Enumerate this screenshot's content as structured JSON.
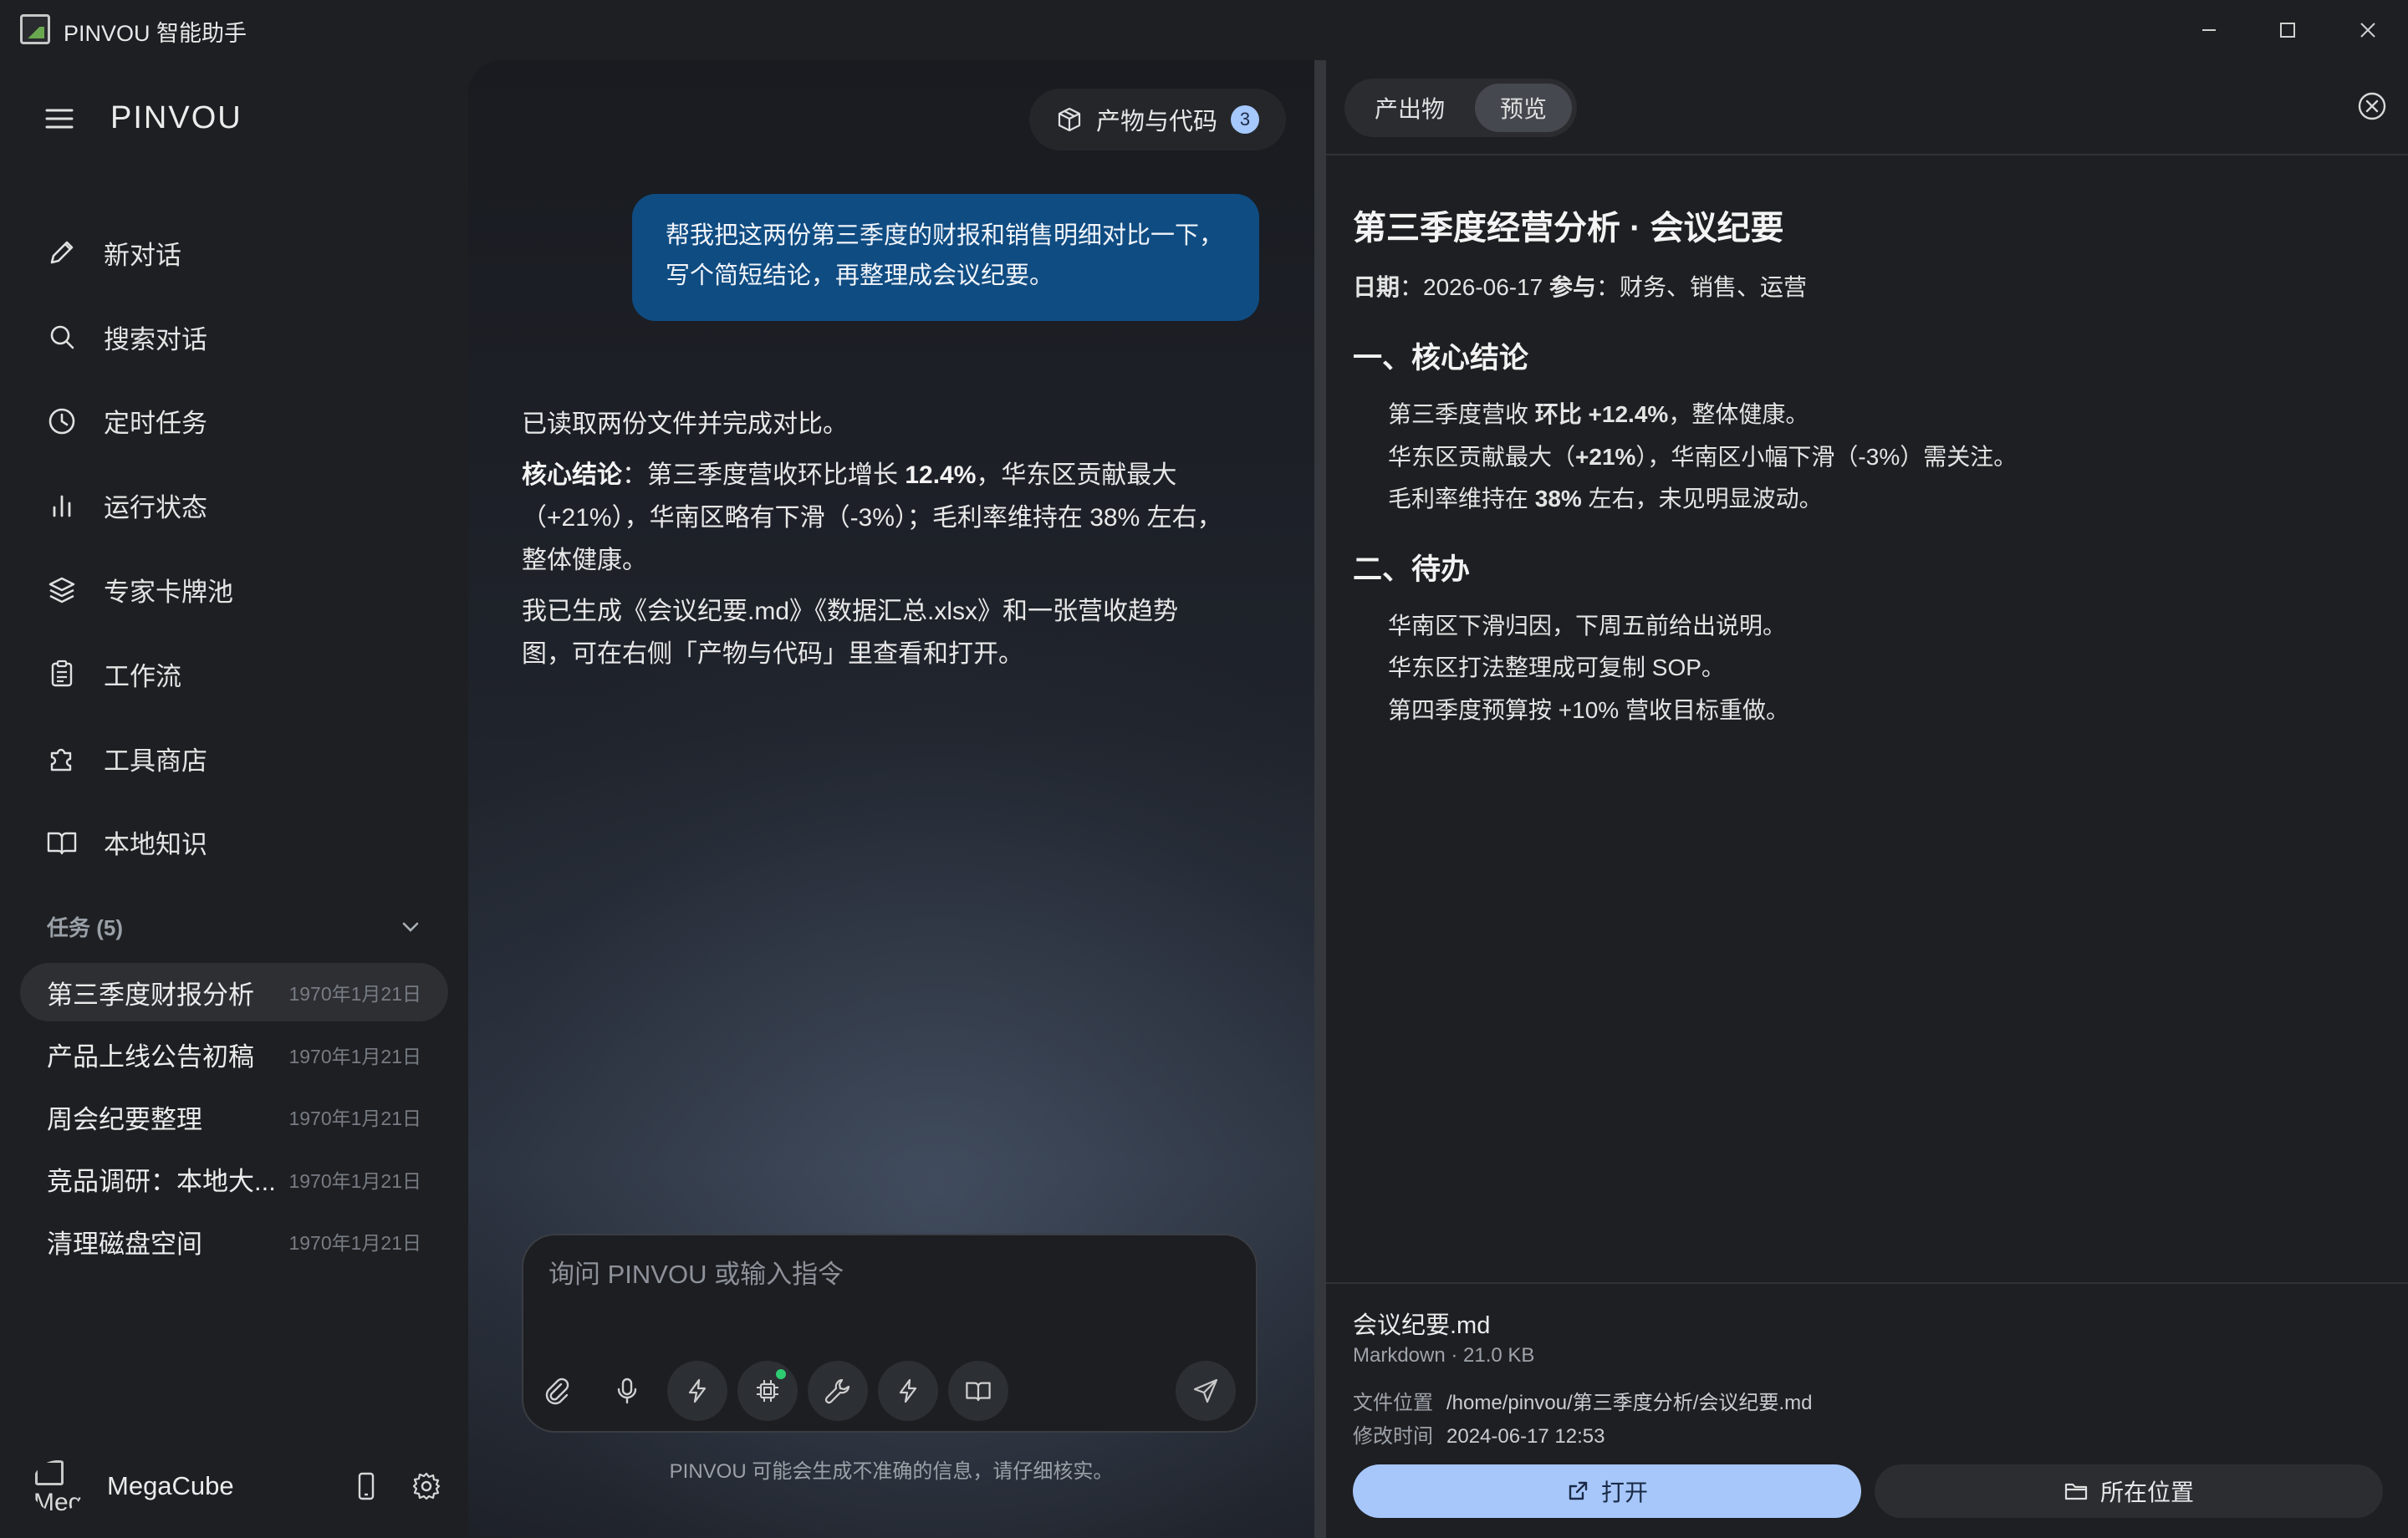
{
  "window": {
    "title": "PINVOU 智能助手"
  },
  "sidebar": {
    "brand": "PINVOU",
    "nav": [
      {
        "label": "新对话",
        "icon": "pencil-icon"
      },
      {
        "label": "搜索对话",
        "icon": "search-icon"
      },
      {
        "label": "定时任务",
        "icon": "clock-icon"
      },
      {
        "label": "运行状态",
        "icon": "bar-chart-icon"
      },
      {
        "label": "专家卡牌池",
        "icon": "layers-icon"
      },
      {
        "label": "工作流",
        "icon": "clipboard-icon"
      },
      {
        "label": "工具商店",
        "icon": "puzzle-icon"
      },
      {
        "label": "本地知识",
        "icon": "book-icon"
      }
    ],
    "tasks_title": "任务 (5)",
    "tasks": [
      {
        "title": "第三季度财报分析",
        "date": "1970年1月21日"
      },
      {
        "title": "产品上线公告初稿",
        "date": "1970年1月21日"
      },
      {
        "title": "周会纪要整理",
        "date": "1970年1月21日"
      },
      {
        "title": "竞品调研：本地大...",
        "date": "1970年1月21日"
      },
      {
        "title": "清理磁盘空间",
        "date": "1970年1月21日"
      }
    ],
    "user": {
      "name": "MegaCube",
      "avatar_alt": "Meg"
    }
  },
  "chat": {
    "artifacts_label": "产物与代码",
    "artifacts_count": "3",
    "user_message": "帮我把这两份第三季度的财报和销售明细对比一下，写个简短结论，再整理成会议纪要。",
    "assistant": {
      "p1": "已读取两份文件并完成对比。",
      "p2_label": "核心结论",
      "p2_text_a": "：第三季度营收环比增长 ",
      "p2_bold": "12.4%",
      "p2_text_b": "，华东区贡献最大（+21%），华南区略有下滑（-3%）；毛利率维持在 38% 左右，整体健康。",
      "p3": "我已生成《会议纪要.md》《数据汇总.xlsx》和一张营收趋势图，可在右侧「产物与代码」里查看和打开。"
    },
    "input_placeholder": "询问 PINVOU 或输入指令",
    "disclaimer": "PINVOU 可能会生成不准确的信息，请仔细核实。"
  },
  "panel": {
    "tabs": [
      "产出物",
      "预览"
    ],
    "active_tab": "预览",
    "doc": {
      "title": "第三季度经营分析 · 会议纪要",
      "date_label": "日期",
      "date": "：2026-06-17 ",
      "participants_label": "参与",
      "participants": "：财务、销售、运营",
      "s1_title": "一、核心结论",
      "s1_l1_a": "第三季度营收 ",
      "s1_l1_b": "环比 +12.4%",
      "s1_l1_c": "，整体健康。",
      "s1_l2_a": "华东区贡献最大（",
      "s1_l2_b": "+21%",
      "s1_l2_c": "），华南区小幅下滑（-3%）需关注。",
      "s1_l3_a": "毛利率维持在 ",
      "s1_l3_b": "38%",
      "s1_l3_c": " 左右，未见明显波动。",
      "s2_title": "二、待办",
      "s2_items": [
        "华南区下滑归因，下周五前给出说明。",
        "华东区打法整理成可复制 SOP。",
        "第四季度预算按 +10% 营收目标重做。"
      ]
    },
    "file": {
      "name": "会议纪要.md",
      "type": "Markdown · 21.0 KB",
      "location_label": "文件位置",
      "location": "/home/pinvou/第三季度分析/会议纪要.md",
      "modified_label": "修改时间",
      "modified": "2024-06-17 12:53",
      "open_label": "打开",
      "reveal_label": "所在位置"
    }
  },
  "colors": {
    "user_bubble": "#0f4c82",
    "accent": "#a7c7fb",
    "status_dot": "#2ecc71"
  }
}
